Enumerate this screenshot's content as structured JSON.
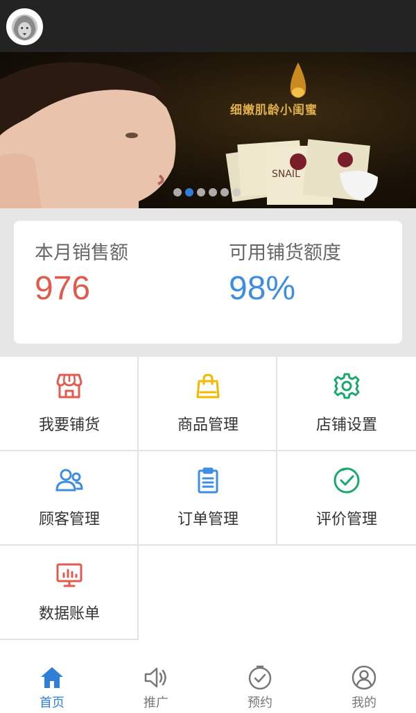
{
  "colors": {
    "accent": "#2f7fd6",
    "sales_value": "#e05a4e",
    "quota_value": "#3d8de0",
    "icon_red": "#e35a4e",
    "icon_yellow": "#f5b800",
    "icon_green": "#1aa86b",
    "icon_blue": "#3d8de0"
  },
  "header": {
    "avatar_icon": "lion-avatar-icon"
  },
  "banner": {
    "caption": "细嫩肌龄小闺蜜",
    "product_text": "SNAIL",
    "slide_count": 6,
    "active_slide": 1
  },
  "stats": {
    "sales": {
      "label": "本月销售额",
      "value": "976"
    },
    "quota": {
      "label": "可用铺货额度",
      "value": "98%"
    }
  },
  "menu": [
    {
      "label": "我要铺货",
      "icon": "storefront-icon"
    },
    {
      "label": "商品管理",
      "icon": "shopping-bag-icon"
    },
    {
      "label": "店铺设置",
      "icon": "gear-icon"
    },
    {
      "label": "顾客管理",
      "icon": "users-icon"
    },
    {
      "label": "订单管理",
      "icon": "clipboard-icon"
    },
    {
      "label": "评价管理",
      "icon": "check-circle-icon"
    },
    {
      "label": "数据账单",
      "icon": "chart-monitor-icon"
    }
  ],
  "bottom_nav": [
    {
      "label": "首页",
      "icon": "home-icon",
      "active": true
    },
    {
      "label": "推广",
      "icon": "speaker-icon",
      "active": false
    },
    {
      "label": "预约",
      "icon": "clock-check-icon",
      "active": false
    },
    {
      "label": "我的",
      "icon": "profile-icon",
      "active": false
    }
  ]
}
